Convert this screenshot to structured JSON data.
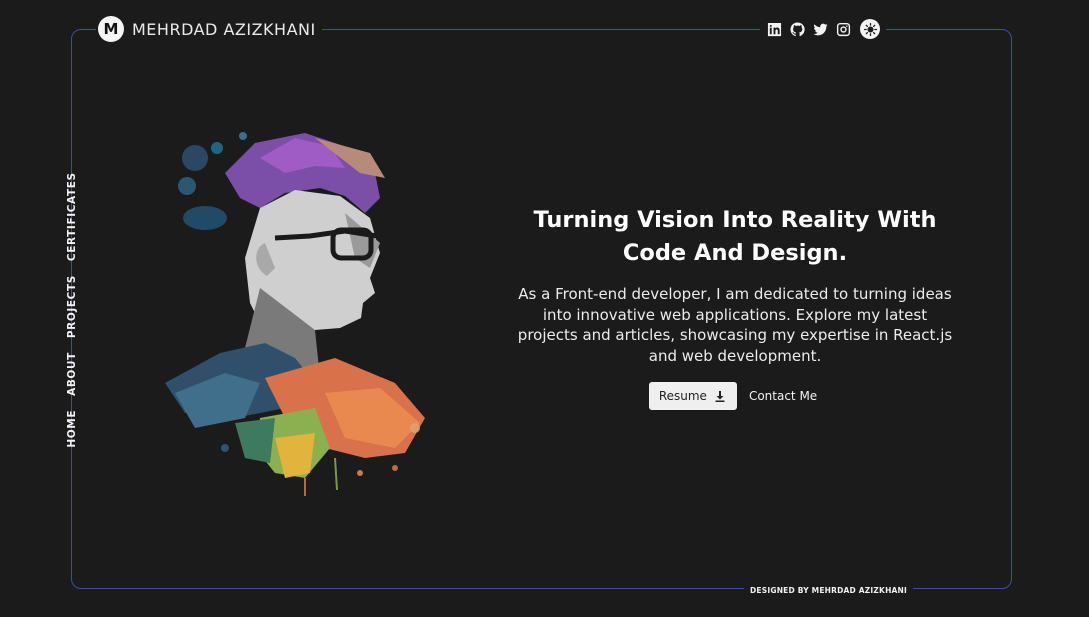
{
  "header": {
    "logo_letter": "M",
    "name": "MEHRDAD AZIZKHANI",
    "social_icons": [
      "linkedin-icon",
      "github-icon",
      "twitter-icon",
      "instagram-icon"
    ],
    "theme_toggle_icon": "sun-icon"
  },
  "nav": {
    "items": [
      {
        "label": "HOME"
      },
      {
        "label": "ABOUT"
      },
      {
        "label": "PROJECTS"
      },
      {
        "label": "CERTIFICATES"
      }
    ]
  },
  "hero": {
    "title_line1": "Turning Vision Into Reality With",
    "title_line2": "Code And Design.",
    "description_lines": [
      "As a Front-end developer, I am dedicated to turning ideas",
      "into innovative web applications. Explore my latest",
      "projects and articles, showcasing my expertise in React.js",
      "and web development."
    ],
    "resume_label": "Resume",
    "resume_icon": "download-icon",
    "contact_label": "Contact Me"
  },
  "footer": {
    "credit": "DESIGNED BY MEHRDAD AZIZKHANI"
  },
  "colors": {
    "background": "#1b1b1c",
    "frame_border": "#3d4f9c",
    "text": "#f2f2f2",
    "button_bg": "#efefef"
  }
}
